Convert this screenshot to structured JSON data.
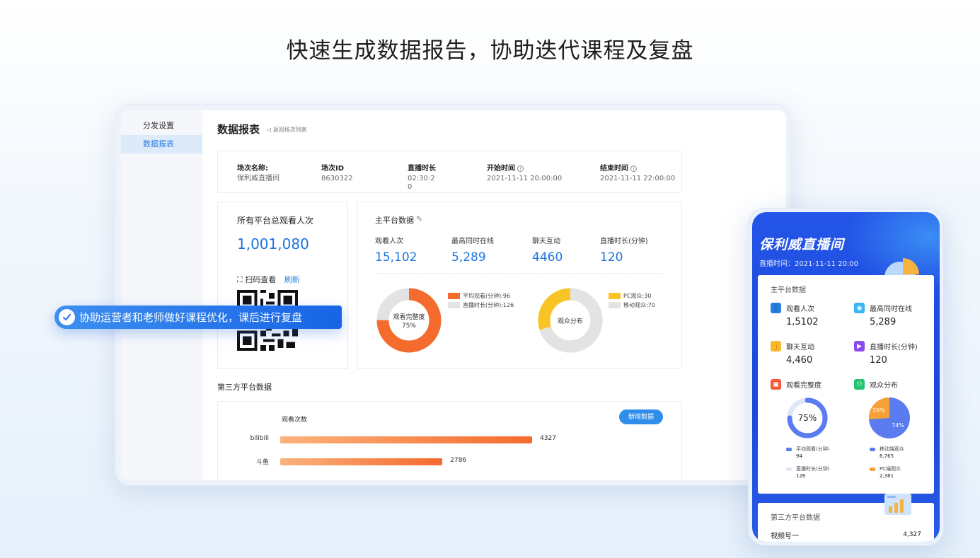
{
  "headline": "快速生成数据报告，协助迭代课程及复盘",
  "sidebar": {
    "items": [
      {
        "label": "分发设置"
      },
      {
        "label": "数据报表"
      }
    ]
  },
  "report": {
    "title": "数据报表",
    "back_label": "◁ 返回场次列表",
    "info": {
      "name_label": "场次名称:",
      "name_value": "保利威直播间",
      "id_label": "场次ID",
      "id_value": "8630322",
      "duration_label": "直播时长",
      "duration_value": "02:30:20",
      "start_label": "开始时间",
      "start_value": "2021-11-11 20:00:00",
      "end_label": "结束时间",
      "end_value": "2021-11-11 22:00:00"
    },
    "total": {
      "label": "所有平台总观看人次",
      "value": "1,001,080",
      "scan_label": "扫码查看",
      "refresh_label": "刷新"
    },
    "main_platform": {
      "title": "主平台数据",
      "metrics": [
        {
          "label": "观看人次",
          "value": "15,102"
        },
        {
          "label": "最高同时在线",
          "value": "5,289"
        },
        {
          "label": "聊天互动",
          "value": "4460"
        },
        {
          "label": "直播时长(分钟)",
          "value": "120"
        }
      ],
      "donut1": {
        "center_label": "观看完整度",
        "center_value": "75%",
        "percent": 75,
        "legend": [
          {
            "label": "平均观看(分钟):96",
            "color": "#f56a2d"
          },
          {
            "label": "直播时长(分钟):126",
            "color": "#e3e3e3"
          }
        ]
      },
      "donut2": {
        "center_label": "观众分布",
        "percent": 30,
        "legend": [
          {
            "label": "PC观众:30",
            "color": "#f7c325"
          },
          {
            "label": "移动观众:70",
            "color": "#e3e3e3"
          }
        ]
      }
    },
    "third_party": {
      "title": "第三方平台数据",
      "header": "观看次数",
      "add_button": "新增数据",
      "bars": [
        {
          "label": "bilibili",
          "value": 4327
        },
        {
          "label": "斗鱼",
          "value": 2786
        }
      ]
    }
  },
  "callout": {
    "text": "协助运营者和老师做好课程优化，课后进行复盘"
  },
  "phone": {
    "title": "保利威直播间",
    "time": "直播时间：2021-11-11 20:00",
    "card_title": "主平台数据",
    "items": [
      {
        "label": "观看人次",
        "value": "1,5102",
        "color": "#2b7de0"
      },
      {
        "label": "最高同时在线",
        "value": "5,289",
        "color": "#3ab4f2"
      },
      {
        "label": "聊天互动",
        "value": "4,460",
        "color": "#f7b731"
      },
      {
        "label": "直播时长(分钟)",
        "value": "120",
        "color": "#8a4af0"
      },
      {
        "label": "观看完整度",
        "color": "#f25a3a"
      },
      {
        "label": "观众分布",
        "color": "#22c36e"
      }
    ],
    "donut": {
      "center_value": "75%",
      "percent": 75
    },
    "pie": {
      "small_label": "26%",
      "large_label": "74%",
      "small_percent": 26
    },
    "legend": [
      {
        "label": "平均观看(分钟)",
        "value": "94",
        "color": "#5b7cf0"
      },
      {
        "label": "直播时长(分钟)",
        "value": "126",
        "color": "#dfe6f7"
      },
      {
        "label": "移动端观众",
        "value": "6,765",
        "color": "#5b7cf0"
      },
      {
        "label": "PC端观众",
        "value": "2,361",
        "color": "#f7a035"
      }
    ],
    "third_title": "第三方平台数据",
    "third_row": {
      "label": "视频号一",
      "value": "4,327"
    }
  }
}
